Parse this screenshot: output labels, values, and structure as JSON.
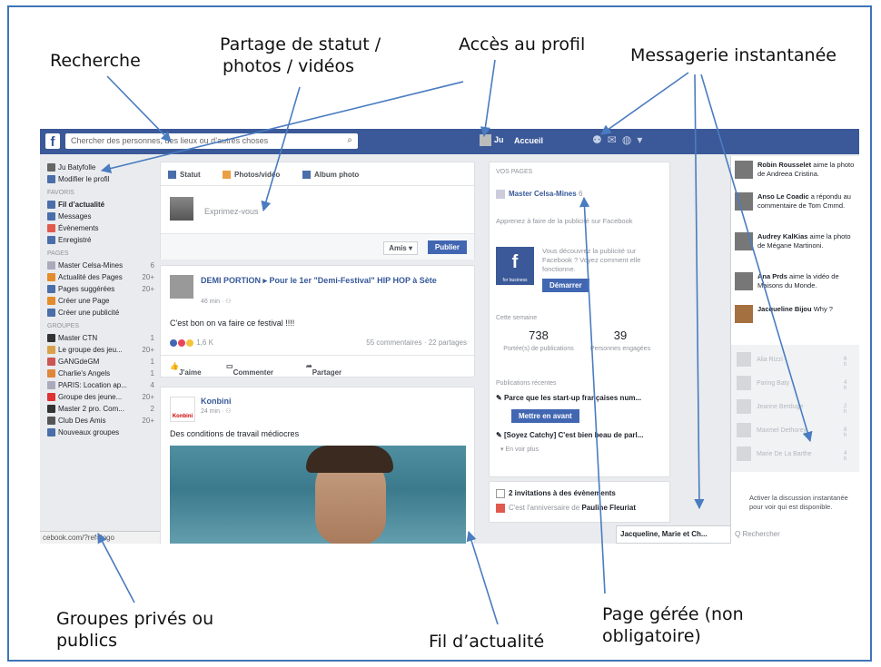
{
  "annotations": {
    "recherche": "Recherche",
    "partage_l1": "Partage de statut /",
    "partage_l2": "photos / vidéos",
    "profil": "Accès au profil",
    "messagerie": "Messagerie instantanée",
    "groupes_l1": "Groupes privés ou",
    "groupes_l2": "publics",
    "fil": "Fil d’actualité",
    "page_l1": "Page gérée (non",
    "page_l2": "obligatoire)"
  },
  "topbar": {
    "logo": "f",
    "search_placeholder": "Chercher des personnes, des lieux ou d’autres choses",
    "user": "Ju",
    "home": "Accueil",
    "icons": [
      "friends-icon",
      "messages-icon",
      "globe-icon",
      "settings-icon"
    ]
  },
  "left": {
    "profile": "Ju Batyfolle",
    "edit": "Modifier le profil",
    "favoris_title": "FAVORIS",
    "favoris": [
      "Fil d’actualité",
      "Messages",
      "Évènements",
      "Enregistré"
    ],
    "pages_title": "PAGES",
    "pages": [
      {
        "label": "Master Celsa-Mines",
        "count": "6"
      },
      {
        "label": "Actualité des Pages",
        "count": "20+"
      },
      {
        "label": "Pages suggérées",
        "count": "20+"
      },
      {
        "label": "Créer une Page",
        "count": ""
      },
      {
        "label": "Créer une publicité",
        "count": ""
      }
    ],
    "groupes_title": "GROUPES",
    "groupes": [
      {
        "label": "Master CTN",
        "count": "1"
      },
      {
        "label": "Le groupe des jeu...",
        "count": "20+"
      },
      {
        "label": "GANGdeGM",
        "count": "1"
      },
      {
        "label": "Charlie's Angels",
        "count": "1"
      },
      {
        "label": "PARIS: Location ap...",
        "count": "4"
      },
      {
        "label": "Groupe des jeune...",
        "count": "20+"
      },
      {
        "label": "Master 2 pro. Com...",
        "count": "2"
      },
      {
        "label": "Club Des Amis",
        "count": "20+"
      },
      {
        "label": "Nouveaux groupes",
        "count": ""
      }
    ],
    "status_url": "cebook.com/?ref=logo"
  },
  "composer": {
    "tab_statut": "Statut",
    "tab_photos": "Photos/vidéo",
    "tab_album": "Album photo",
    "placeholder": "Exprimez-vous",
    "audience": "Amis ▾",
    "publish": "Publier"
  },
  "post1": {
    "title": "DEMI PORTION ▸ Pour le 1er \"Demi-Festival\" HIP HOP à Sète",
    "time": "46 min · ⚇",
    "text": "C'est bon on va faire ce festival !!!!",
    "reactions": "1,6 K",
    "stats": "55 commentaires · 22 partages",
    "like": "J'aime",
    "comment": "Commenter",
    "share": "Partager"
  },
  "post2": {
    "logo": "Konbini",
    "name": "Konbini",
    "time": "24 min · ⚇",
    "text": "Des conditions de travail médiocres"
  },
  "pages_panel": {
    "header": "VOS PAGES",
    "page_name": "Master Celsa-Mines",
    "page_badge": "6",
    "promo": "Apprenez à faire de la publicité sur Facebook",
    "fb_caption": "for business",
    "desc": "Vous découvrez la publicité sur Facebook ? Voyez comment elle fonctionne.",
    "start": "Démarrer",
    "week": "Cette semaine",
    "n1": "738",
    "l1": "Portée(s) de publications",
    "n2": "39",
    "l2": "Personnes engagées",
    "recent": "Publications récentes",
    "r1": "Parce que les start-up françaises num...",
    "boost": "Mettre en avant",
    "r2": "[Soyez Catchy] C'est bien beau de parl...",
    "more": "▾ En voir plus"
  },
  "events": {
    "invites": "2 invitations à des évènements",
    "bday_pre": "C'est l'anniversaire de ",
    "bday_name": "Pauline Fleuriat"
  },
  "chatbar": "Jacqueline, Marie et Ch...",
  "ticker": [
    {
      "name": "Robin Rousselet",
      "text": " aime la photo de Andreea Cristina."
    },
    {
      "name": "Anso Le Coadic",
      "text": " a répondu au commentaire de Tom Cmmd."
    },
    {
      "name": "Audrey KalKias",
      "text": " aime la photo de Mégane Martinoni."
    },
    {
      "name": "Ana Prds",
      "text": " aime la vidéo de Maisons du Monde."
    },
    {
      "name": "Jacqueline Bijou",
      "text": " Why ?"
    }
  ],
  "contacts": [
    {
      "name": "Alia Rizzi",
      "time": "6 h"
    },
    {
      "name": "Paring Baty",
      "time": "4 h"
    },
    {
      "name": "Jeanne Berduge",
      "time": "2 h"
    },
    {
      "name": "Maxmel Dethorey",
      "time": "8 h"
    },
    {
      "name": "Marie De La Barthe",
      "time": "4 h"
    }
  ],
  "chat_activate": "Activer la discussion instantanée pour voir qui est disponible.",
  "chat_search": "Q Rechercher"
}
